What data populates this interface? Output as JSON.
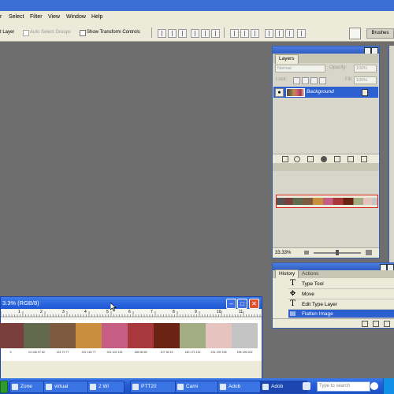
{
  "menu": {
    "items": [
      "r",
      "Select",
      "Filter",
      "View",
      "Window",
      "Help"
    ]
  },
  "options": {
    "auto_layer_label": "t Layer",
    "auto_select_groups_label": "Auto Select Groups",
    "show_transform_label": "Show Transform Controls",
    "brushes_tab": "Brushes"
  },
  "layers_panel": {
    "tab_label": "Layers",
    "blend_mode": "Normal",
    "opacity_label": "Opacity:",
    "opacity_value": "100%",
    "lock_label": "Lock:",
    "fill_label": "Fill:",
    "fill_value": "100%",
    "layer_name": "Background"
  },
  "navigator": {
    "zoom": "33.33%"
  },
  "history_panel": {
    "tabs": [
      "History",
      "Actions"
    ],
    "steps": [
      "Type Tool",
      "Move",
      "Edit Type Layer",
      "Flatten Image"
    ]
  },
  "document": {
    "title": "3.3% (RGB/8)",
    "ruler_marks": [
      "1",
      "2",
      "3",
      "4",
      "5",
      "6",
      "7",
      "8",
      "9",
      "10",
      "11"
    ],
    "swatches": [
      {
        "color": "#7a3f3d",
        "code": "5"
      },
      {
        "color": "#616a4c",
        "code": "24 106 97 82"
      },
      {
        "color": "#7d5b3f",
        "code": "124 79 77"
      },
      {
        "color": "#c98f3f",
        "code": "201 146 77"
      },
      {
        "color": "#c55e82",
        "code": "201 102 144"
      },
      {
        "color": "#a8383b",
        "code": "168 56 65"
      },
      {
        "color": "#6b2413",
        "code": "107 36 19"
      },
      {
        "color": "#a3ad84",
        "code": "160 173 132"
      },
      {
        "color": "#e6c3be",
        "code": "231 199 198"
      },
      {
        "color": "#c4c4c4",
        "code": "196 196 202"
      }
    ]
  },
  "taskbar": {
    "items": [
      "Zone",
      "virtual",
      "2 Wi",
      "PTT20",
      "Cami",
      "Adob",
      "Adob"
    ],
    "search_placeholder": "Type to search"
  }
}
